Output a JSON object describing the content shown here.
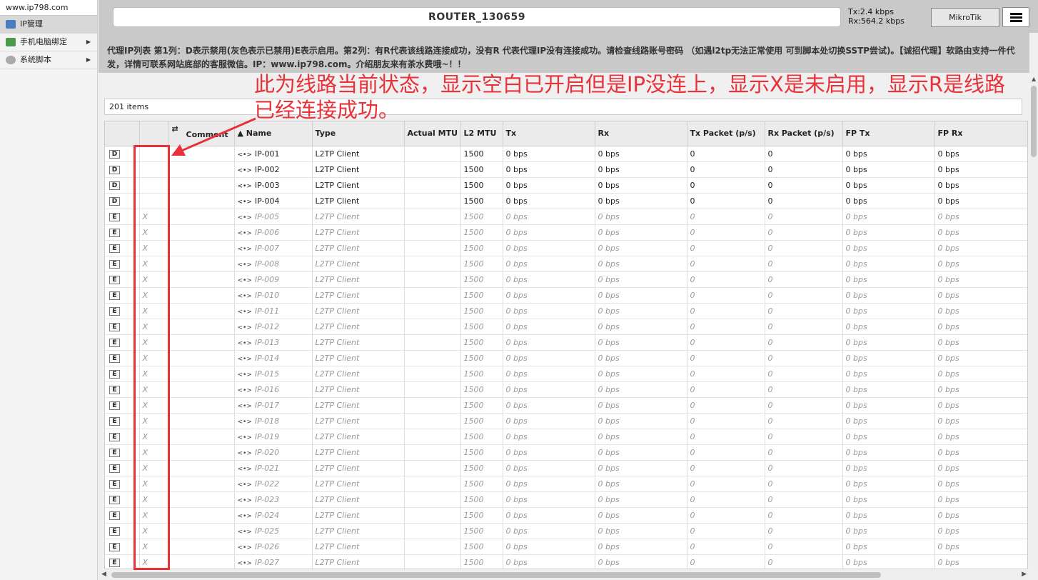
{
  "sidebar": {
    "site": "www.ip798.com",
    "items": [
      {
        "label": "IP管理",
        "icon": "network-icon",
        "color": "#4a7cc0",
        "has_arrow": false
      },
      {
        "label": "手机电脑绑定",
        "icon": "devices-icon",
        "color": "#4a9a4a",
        "has_arrow": true
      },
      {
        "label": "系统脚本",
        "icon": "gear-icon",
        "color": "#888888",
        "has_arrow": true
      }
    ]
  },
  "header": {
    "title": "ROUTER_130659",
    "tx": "Tx:2.4 kbps",
    "rx": "Rx:564.2 kbps",
    "brand": "MikroTik"
  },
  "notice": "代理IP列表 第1列：D表示禁用(灰色表示已禁用)E表示启用。第2列：有R代表该线路连接成功，没有R 代表代理IP没有连接成功。请检查线路账号密码 （如遇l2tp无法正常使用 可到脚本处切换SSTP尝试)。【诚招代理】软路由支持一件代发，详情可联系网站底部的客服微信。IP：www.ip798.com。介绍朋友来有茶水费哦~！！",
  "items_count": "201 items",
  "annotation": "此为线路当前状态，显示空白已开启但是IP没连上，显示X是未启用，显示R是线路已经连接成功。",
  "table": {
    "columns": [
      "",
      "",
      "Comment",
      "▲ Name",
      "Type",
      "Actual MTU",
      "L2 MTU",
      "Tx",
      "Rx",
      "Tx Packet (p/s)",
      "Rx Packet (p/s)",
      "FP Tx",
      "FP Rx"
    ],
    "rows": [
      {
        "flag": "D",
        "status": "",
        "name": "IP-001",
        "type": "L2TP Client",
        "actual_mtu": "",
        "l2mtu": "1500",
        "tx": "0 bps",
        "rx": "0 bps",
        "txp": "0",
        "rxp": "0",
        "fptx": "0 bps",
        "fprx": "0 bps",
        "disabled": false
      },
      {
        "flag": "D",
        "status": "",
        "name": "IP-002",
        "type": "L2TP Client",
        "actual_mtu": "",
        "l2mtu": "1500",
        "tx": "0 bps",
        "rx": "0 bps",
        "txp": "0",
        "rxp": "0",
        "fptx": "0 bps",
        "fprx": "0 bps",
        "disabled": false
      },
      {
        "flag": "D",
        "status": "",
        "name": "IP-003",
        "type": "L2TP Client",
        "actual_mtu": "",
        "l2mtu": "1500",
        "tx": "0 bps",
        "rx": "0 bps",
        "txp": "0",
        "rxp": "0",
        "fptx": "0 bps",
        "fprx": "0 bps",
        "disabled": false
      },
      {
        "flag": "D",
        "status": "",
        "name": "IP-004",
        "type": "L2TP Client",
        "actual_mtu": "",
        "l2mtu": "1500",
        "tx": "0 bps",
        "rx": "0 bps",
        "txp": "0",
        "rxp": "0",
        "fptx": "0 bps",
        "fprx": "0 bps",
        "disabled": false
      },
      {
        "flag": "E",
        "status": "X",
        "name": "IP-005",
        "type": "L2TP Client",
        "actual_mtu": "",
        "l2mtu": "1500",
        "tx": "0 bps",
        "rx": "0 bps",
        "txp": "0",
        "rxp": "0",
        "fptx": "0 bps",
        "fprx": "0 bps",
        "disabled": true
      },
      {
        "flag": "E",
        "status": "X",
        "name": "IP-006",
        "type": "L2TP Client",
        "actual_mtu": "",
        "l2mtu": "1500",
        "tx": "0 bps",
        "rx": "0 bps",
        "txp": "0",
        "rxp": "0",
        "fptx": "0 bps",
        "fprx": "0 bps",
        "disabled": true
      },
      {
        "flag": "E",
        "status": "X",
        "name": "IP-007",
        "type": "L2TP Client",
        "actual_mtu": "",
        "l2mtu": "1500",
        "tx": "0 bps",
        "rx": "0 bps",
        "txp": "0",
        "rxp": "0",
        "fptx": "0 bps",
        "fprx": "0 bps",
        "disabled": true
      },
      {
        "flag": "E",
        "status": "X",
        "name": "IP-008",
        "type": "L2TP Client",
        "actual_mtu": "",
        "l2mtu": "1500",
        "tx": "0 bps",
        "rx": "0 bps",
        "txp": "0",
        "rxp": "0",
        "fptx": "0 bps",
        "fprx": "0 bps",
        "disabled": true
      },
      {
        "flag": "E",
        "status": "X",
        "name": "IP-009",
        "type": "L2TP Client",
        "actual_mtu": "",
        "l2mtu": "1500",
        "tx": "0 bps",
        "rx": "0 bps",
        "txp": "0",
        "rxp": "0",
        "fptx": "0 bps",
        "fprx": "0 bps",
        "disabled": true
      },
      {
        "flag": "E",
        "status": "X",
        "name": "IP-010",
        "type": "L2TP Client",
        "actual_mtu": "",
        "l2mtu": "1500",
        "tx": "0 bps",
        "rx": "0 bps",
        "txp": "0",
        "rxp": "0",
        "fptx": "0 bps",
        "fprx": "0 bps",
        "disabled": true
      },
      {
        "flag": "E",
        "status": "X",
        "name": "IP-011",
        "type": "L2TP Client",
        "actual_mtu": "",
        "l2mtu": "1500",
        "tx": "0 bps",
        "rx": "0 bps",
        "txp": "0",
        "rxp": "0",
        "fptx": "0 bps",
        "fprx": "0 bps",
        "disabled": true
      },
      {
        "flag": "E",
        "status": "X",
        "name": "IP-012",
        "type": "L2TP Client",
        "actual_mtu": "",
        "l2mtu": "1500",
        "tx": "0 bps",
        "rx": "0 bps",
        "txp": "0",
        "rxp": "0",
        "fptx": "0 bps",
        "fprx": "0 bps",
        "disabled": true
      },
      {
        "flag": "E",
        "status": "X",
        "name": "IP-013",
        "type": "L2TP Client",
        "actual_mtu": "",
        "l2mtu": "1500",
        "tx": "0 bps",
        "rx": "0 bps",
        "txp": "0",
        "rxp": "0",
        "fptx": "0 bps",
        "fprx": "0 bps",
        "disabled": true
      },
      {
        "flag": "E",
        "status": "X",
        "name": "IP-014",
        "type": "L2TP Client",
        "actual_mtu": "",
        "l2mtu": "1500",
        "tx": "0 bps",
        "rx": "0 bps",
        "txp": "0",
        "rxp": "0",
        "fptx": "0 bps",
        "fprx": "0 bps",
        "disabled": true
      },
      {
        "flag": "E",
        "status": "X",
        "name": "IP-015",
        "type": "L2TP Client",
        "actual_mtu": "",
        "l2mtu": "1500",
        "tx": "0 bps",
        "rx": "0 bps",
        "txp": "0",
        "rxp": "0",
        "fptx": "0 bps",
        "fprx": "0 bps",
        "disabled": true
      },
      {
        "flag": "E",
        "status": "X",
        "name": "IP-016",
        "type": "L2TP Client",
        "actual_mtu": "",
        "l2mtu": "1500",
        "tx": "0 bps",
        "rx": "0 bps",
        "txp": "0",
        "rxp": "0",
        "fptx": "0 bps",
        "fprx": "0 bps",
        "disabled": true
      },
      {
        "flag": "E",
        "status": "X",
        "name": "IP-017",
        "type": "L2TP Client",
        "actual_mtu": "",
        "l2mtu": "1500",
        "tx": "0 bps",
        "rx": "0 bps",
        "txp": "0",
        "rxp": "0",
        "fptx": "0 bps",
        "fprx": "0 bps",
        "disabled": true
      },
      {
        "flag": "E",
        "status": "X",
        "name": "IP-018",
        "type": "L2TP Client",
        "actual_mtu": "",
        "l2mtu": "1500",
        "tx": "0 bps",
        "rx": "0 bps",
        "txp": "0",
        "rxp": "0",
        "fptx": "0 bps",
        "fprx": "0 bps",
        "disabled": true
      },
      {
        "flag": "E",
        "status": "X",
        "name": "IP-019",
        "type": "L2TP Client",
        "actual_mtu": "",
        "l2mtu": "1500",
        "tx": "0 bps",
        "rx": "0 bps",
        "txp": "0",
        "rxp": "0",
        "fptx": "0 bps",
        "fprx": "0 bps",
        "disabled": true
      },
      {
        "flag": "E",
        "status": "X",
        "name": "IP-020",
        "type": "L2TP Client",
        "actual_mtu": "",
        "l2mtu": "1500",
        "tx": "0 bps",
        "rx": "0 bps",
        "txp": "0",
        "rxp": "0",
        "fptx": "0 bps",
        "fprx": "0 bps",
        "disabled": true
      },
      {
        "flag": "E",
        "status": "X",
        "name": "IP-021",
        "type": "L2TP Client",
        "actual_mtu": "",
        "l2mtu": "1500",
        "tx": "0 bps",
        "rx": "0 bps",
        "txp": "0",
        "rxp": "0",
        "fptx": "0 bps",
        "fprx": "0 bps",
        "disabled": true
      },
      {
        "flag": "E",
        "status": "X",
        "name": "IP-022",
        "type": "L2TP Client",
        "actual_mtu": "",
        "l2mtu": "1500",
        "tx": "0 bps",
        "rx": "0 bps",
        "txp": "0",
        "rxp": "0",
        "fptx": "0 bps",
        "fprx": "0 bps",
        "disabled": true
      },
      {
        "flag": "E",
        "status": "X",
        "name": "IP-023",
        "type": "L2TP Client",
        "actual_mtu": "",
        "l2mtu": "1500",
        "tx": "0 bps",
        "rx": "0 bps",
        "txp": "0",
        "rxp": "0",
        "fptx": "0 bps",
        "fprx": "0 bps",
        "disabled": true
      },
      {
        "flag": "E",
        "status": "X",
        "name": "IP-024",
        "type": "L2TP Client",
        "actual_mtu": "",
        "l2mtu": "1500",
        "tx": "0 bps",
        "rx": "0 bps",
        "txp": "0",
        "rxp": "0",
        "fptx": "0 bps",
        "fprx": "0 bps",
        "disabled": true
      },
      {
        "flag": "E",
        "status": "X",
        "name": "IP-025",
        "type": "L2TP Client",
        "actual_mtu": "",
        "l2mtu": "1500",
        "tx": "0 bps",
        "rx": "0 bps",
        "txp": "0",
        "rxp": "0",
        "fptx": "0 bps",
        "fprx": "0 bps",
        "disabled": true
      },
      {
        "flag": "E",
        "status": "X",
        "name": "IP-026",
        "type": "L2TP Client",
        "actual_mtu": "",
        "l2mtu": "1500",
        "tx": "0 bps",
        "rx": "0 bps",
        "txp": "0",
        "rxp": "0",
        "fptx": "0 bps",
        "fprx": "0 bps",
        "disabled": true
      },
      {
        "flag": "E",
        "status": "X",
        "name": "IP-027",
        "type": "L2TP Client",
        "actual_mtu": "",
        "l2mtu": "1500",
        "tx": "0 bps",
        "rx": "0 bps",
        "txp": "0",
        "rxp": "0",
        "fptx": "0 bps",
        "fprx": "0 bps",
        "disabled": true
      }
    ]
  },
  "colors": {
    "annotation": "#e8323a",
    "header_bg": "#c9c9c9"
  }
}
